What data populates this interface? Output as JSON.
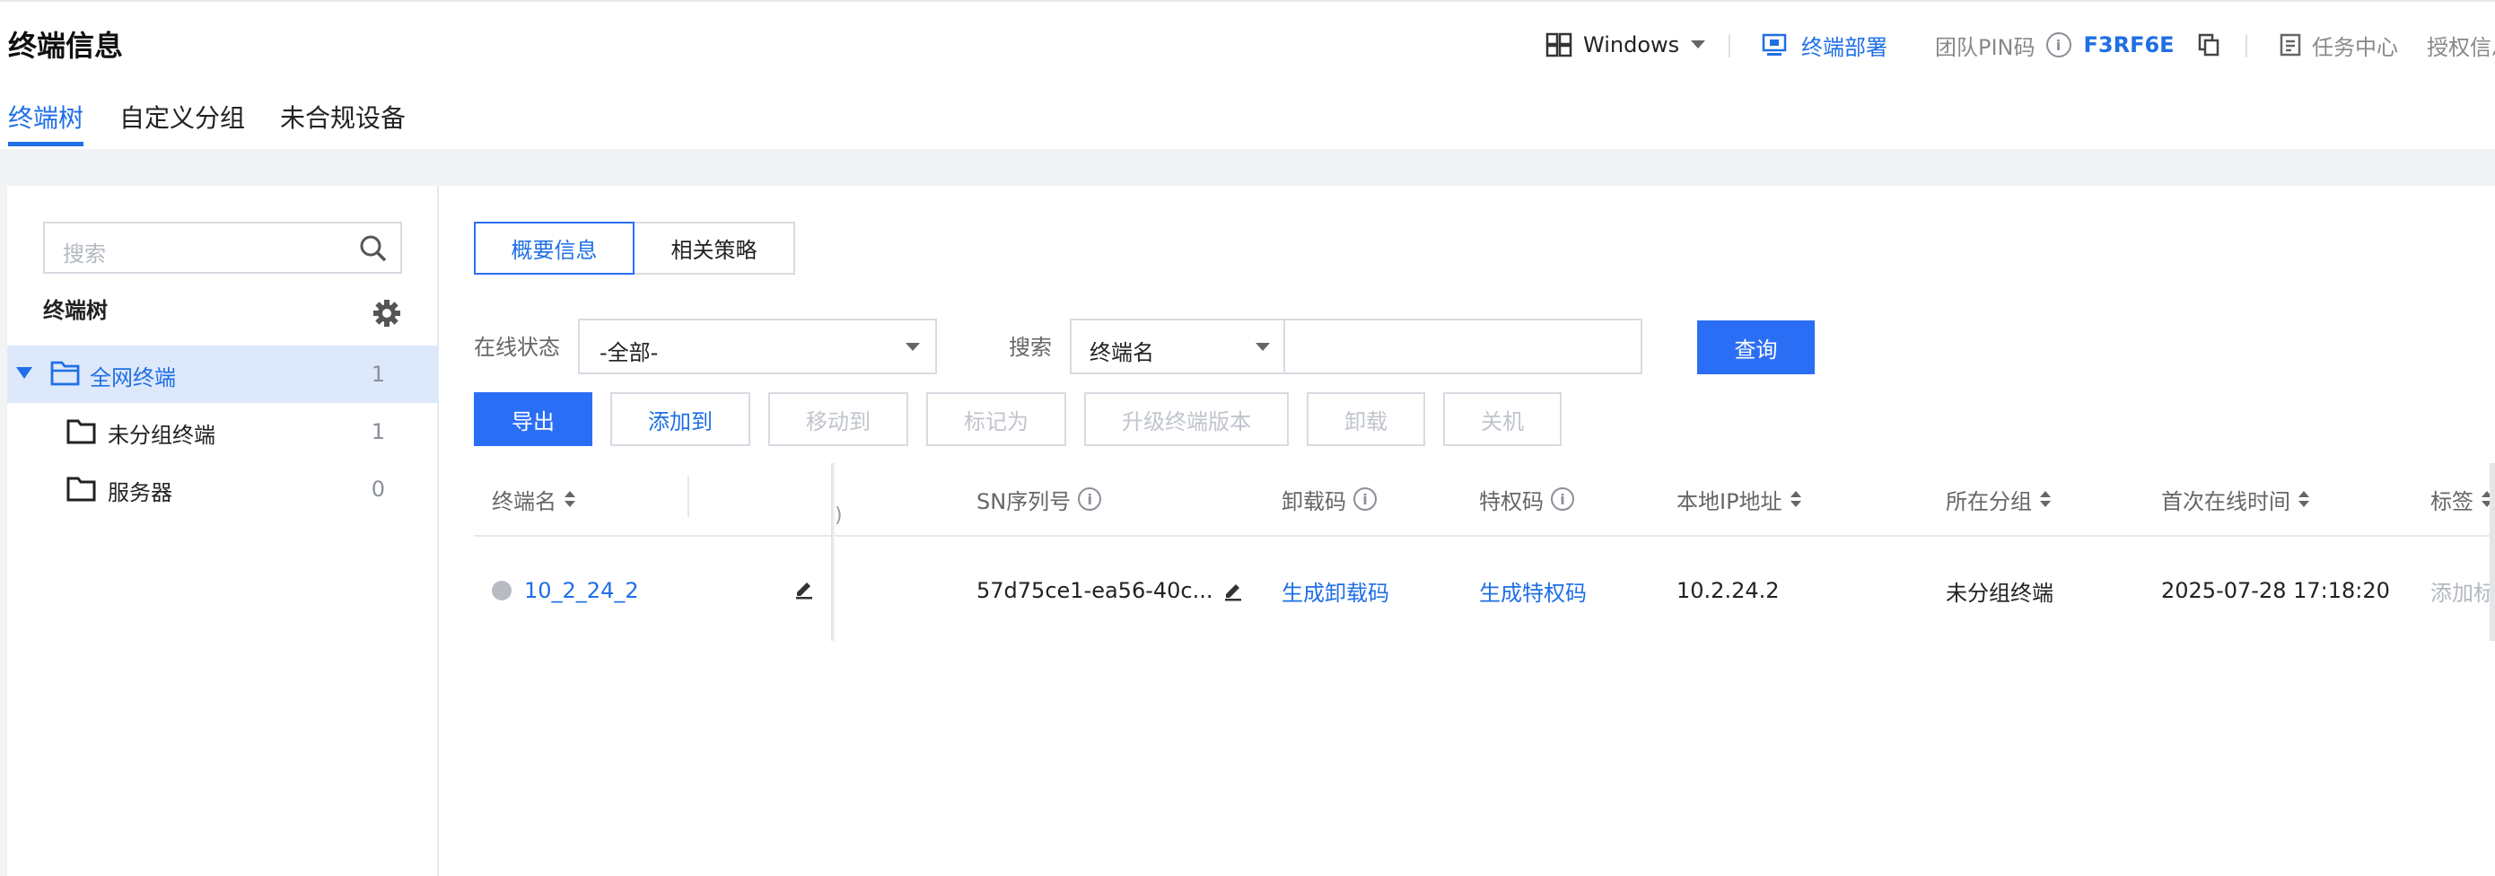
{
  "header": {
    "title": "终端信息",
    "os_label": "Windows",
    "deploy_label": "终端部署",
    "pin_label": "团队PIN码",
    "pin_value": "F3RF6E",
    "task_center": "任务中心",
    "auth_label": "授权信息"
  },
  "tabs": [
    {
      "label": "终端树"
    },
    {
      "label": "自定义分组"
    },
    {
      "label": "未合规设备"
    }
  ],
  "sidebar": {
    "search_placeholder": "搜索",
    "tree_title": "终端树",
    "items": [
      {
        "label": "全网终端",
        "count": "1"
      },
      {
        "label": "未分组终端",
        "count": "1"
      },
      {
        "label": "服务器",
        "count": "0"
      }
    ]
  },
  "main": {
    "subtabs": [
      {
        "label": "概要信息"
      },
      {
        "label": "相关策略"
      }
    ],
    "filters": {
      "status_label": "在线状态",
      "status_value": "-全部-",
      "search_label": "搜索",
      "search_field": "终端名",
      "search_value": "",
      "query_button": "查询"
    },
    "actions": {
      "export": "导出",
      "add_to": "添加到",
      "move_to": "移动到",
      "mark_as": "标记为",
      "upgrade": "升级终端版本",
      "uninstall": "卸载",
      "shutdown": "关机"
    },
    "table": {
      "columns": {
        "name": "终端名",
        "sn": "SN序列号",
        "uninstall_code": "卸载码",
        "privilege_code": "特权码",
        "ip": "本地IP地址",
        "group": "所在分组",
        "first_online": "首次在线时间",
        "tags": "标签"
      },
      "rows": [
        {
          "name": "10_2_24_2",
          "status": "offline",
          "sn": "57d75ce1-ea56-40c...",
          "uninstall_code": "生成卸载码",
          "privilege_code": "生成特权码",
          "ip": "10.2.24.2",
          "group": "未分组终端",
          "first_online": "2025-07-28 17:18:20",
          "tags": "添加标签"
        }
      ]
    }
  },
  "colors": {
    "accent": "#1f6fe5",
    "primary_button": "#2b6ef6",
    "selected_row": "#dde8fb",
    "offline_dot": "#b8bbc2"
  }
}
